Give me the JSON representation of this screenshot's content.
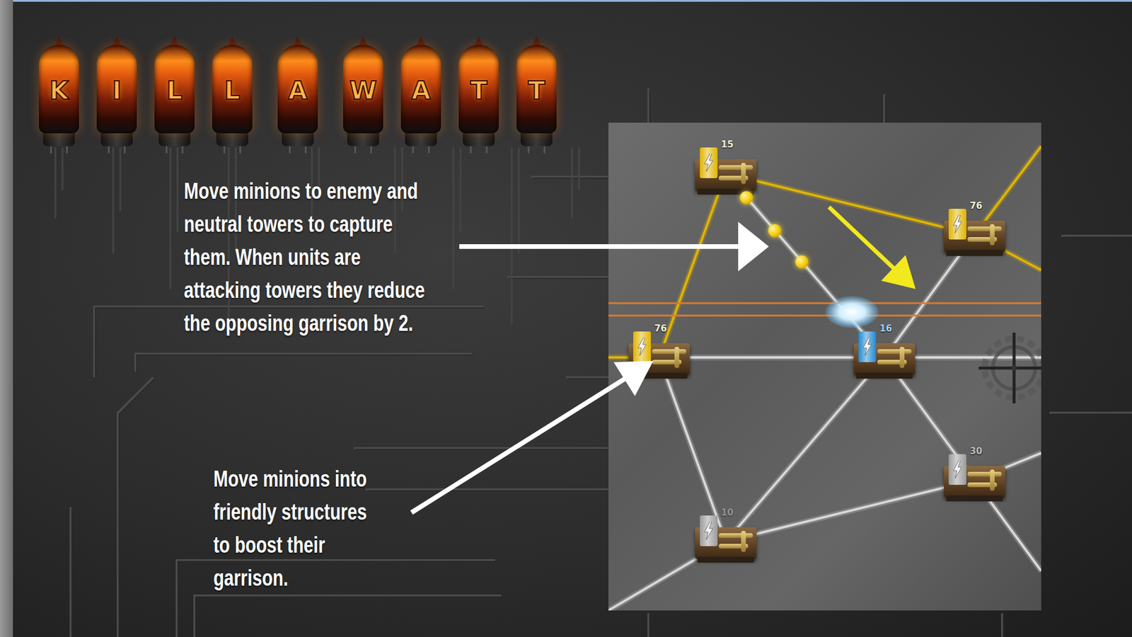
{
  "logo": {
    "words": [
      [
        "K",
        "I",
        "L",
        "L"
      ],
      [
        "A"
      ],
      [
        "W",
        "A",
        "T",
        "T"
      ]
    ]
  },
  "callouts": [
    {
      "lines": [
        "Move minions to enemy and",
        "neutral towers to capture",
        "them. When units are",
        "attacking towers they reduce",
        "the opposing garrison by 2."
      ]
    },
    {
      "lines": [
        "Move minions into",
        "friendly structures",
        "to boost their",
        "garrison."
      ]
    }
  ],
  "map": {
    "towers": [
      {
        "garrison": "15",
        "owner": "player",
        "color": "#e0b400"
      },
      {
        "garrison": "76",
        "owner": "player",
        "color": "#e0b400"
      },
      {
        "garrison": "76",
        "owner": "player",
        "color": "#e0b400"
      },
      {
        "garrison": "16",
        "owner": "enemy",
        "color": "#1e88d0"
      },
      {
        "garrison": "30",
        "owner": "neutral",
        "color": "#9a9a9a"
      },
      {
        "garrison": "10",
        "owner": "neutral",
        "color": "#9a9a9a"
      }
    ],
    "minions": [
      {
        "color": "#f5c800"
      },
      {
        "color": "#f5c800"
      },
      {
        "color": "#f5c800"
      }
    ]
  }
}
